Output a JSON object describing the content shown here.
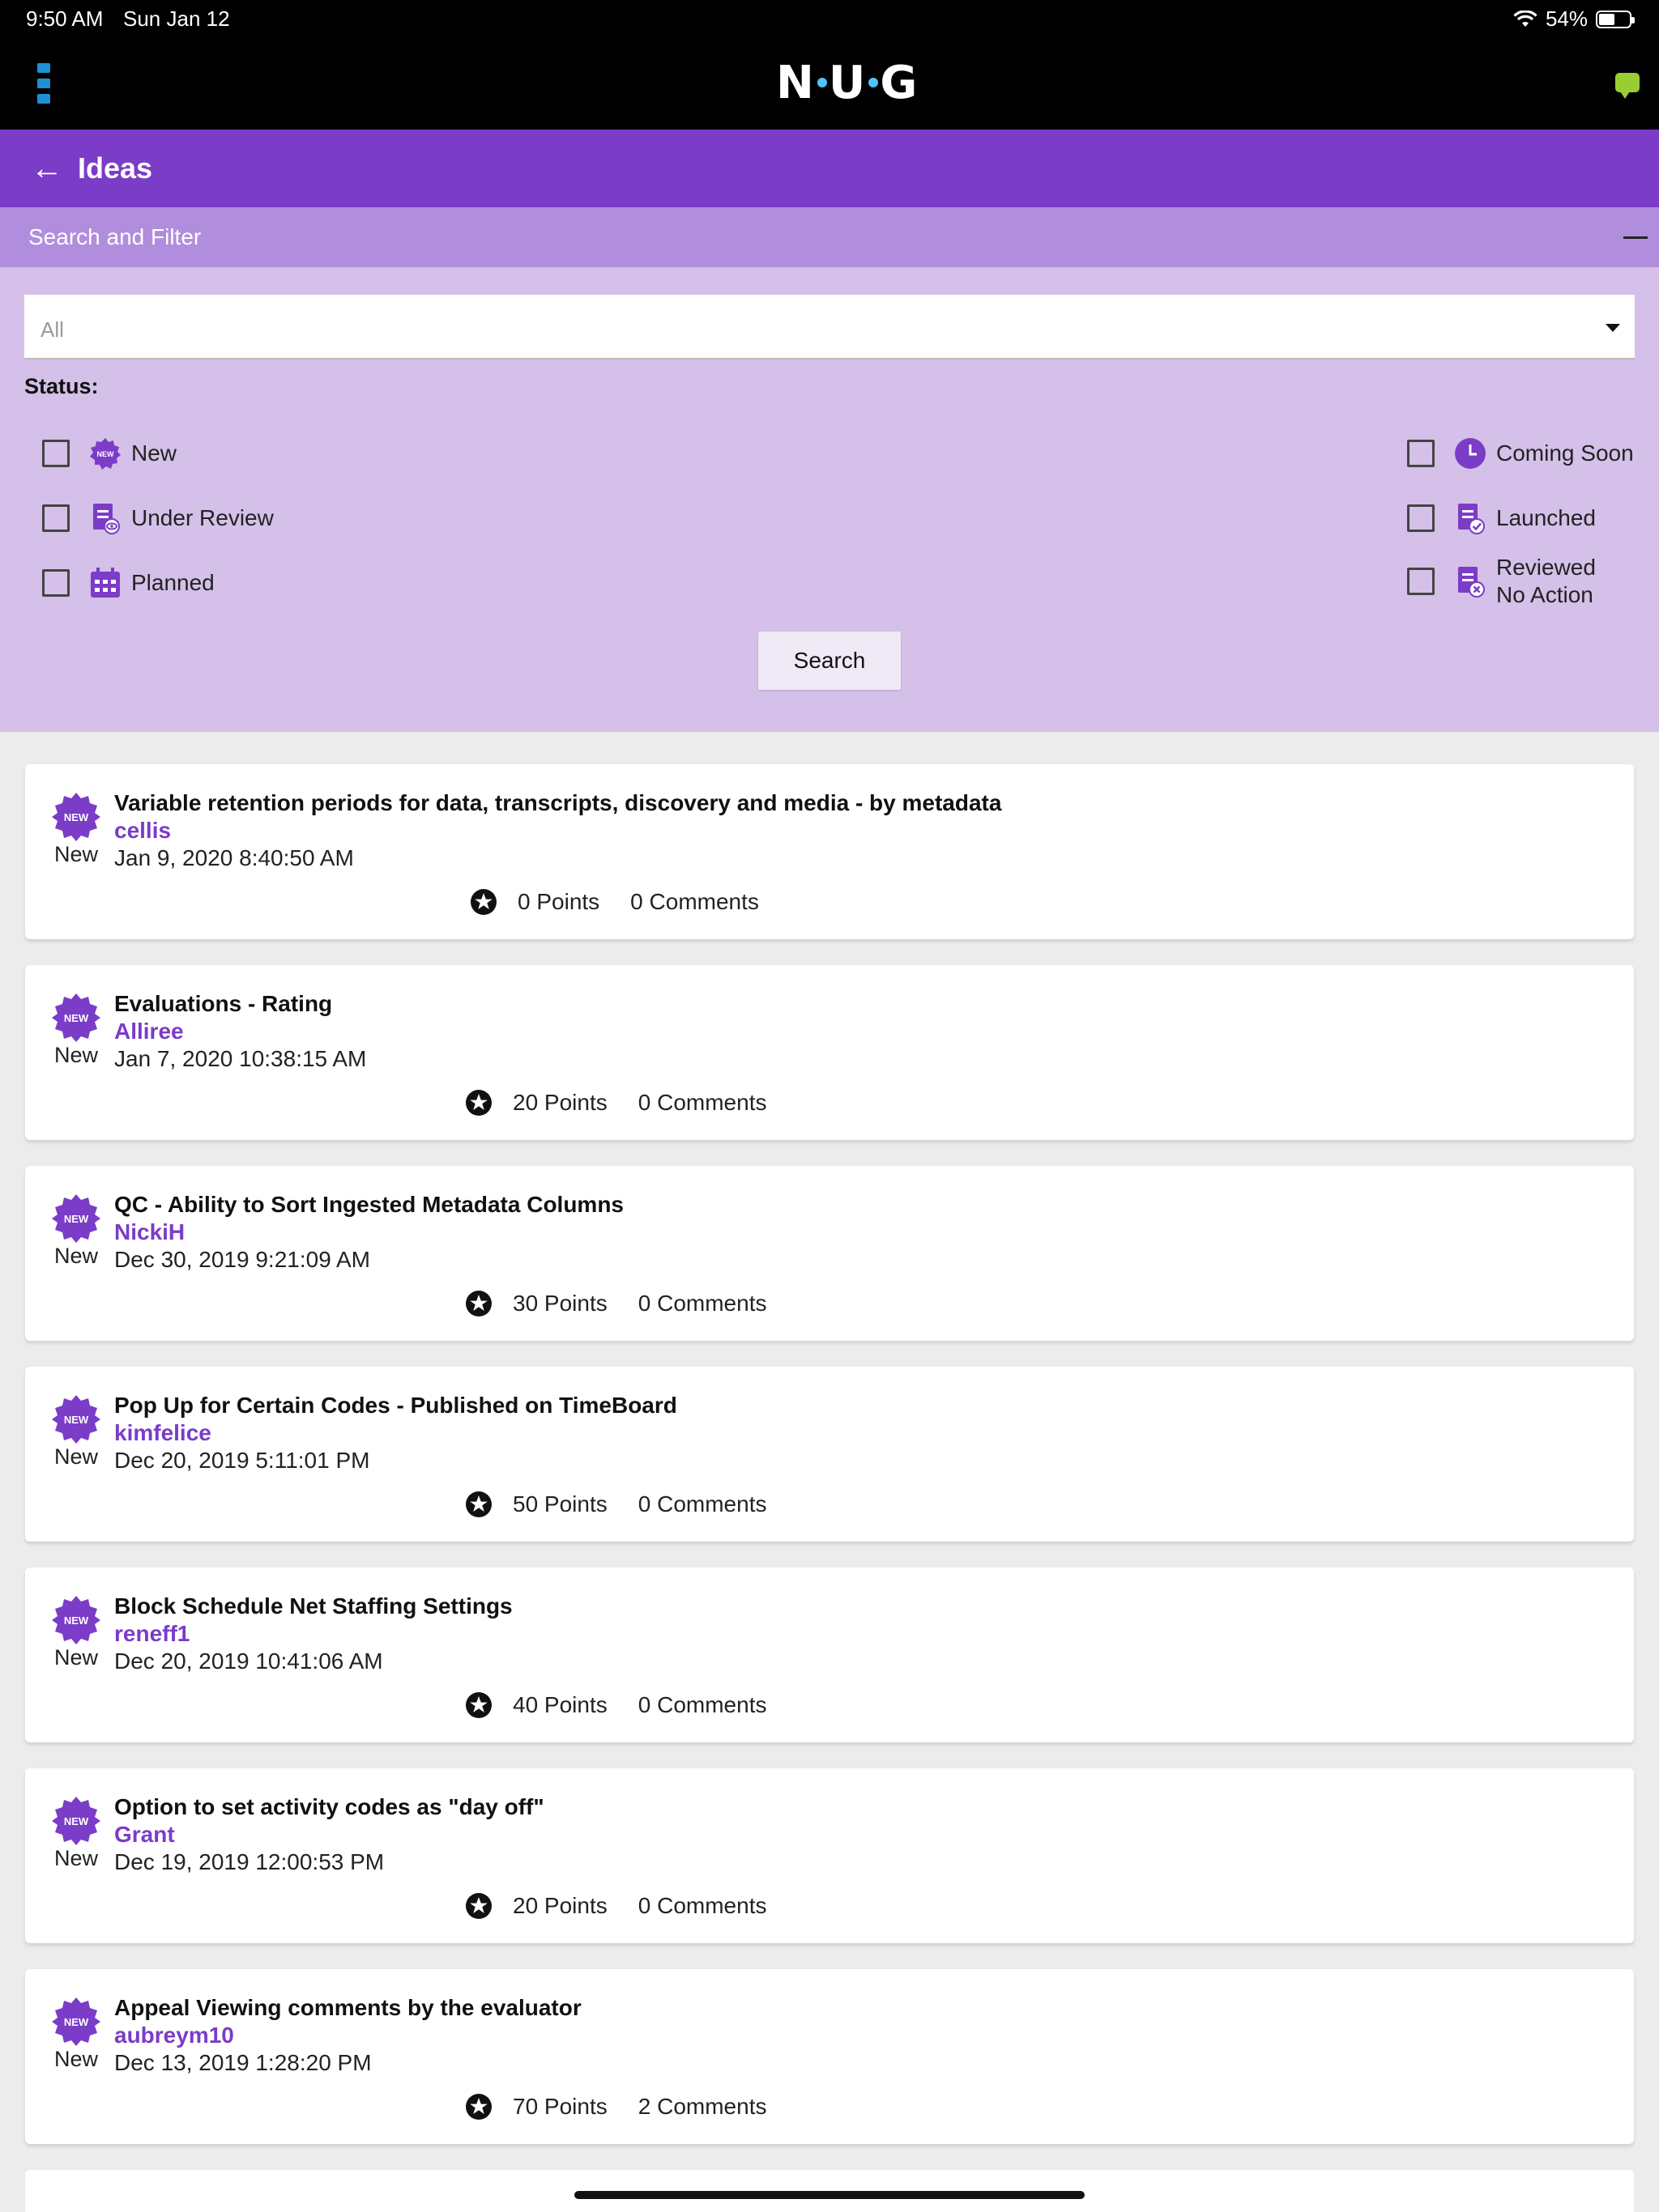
{
  "status_bar": {
    "time": "9:50 AM",
    "date": "Sun Jan 12",
    "battery": "54%",
    "battery_level": 0.54,
    "icons": [
      "wifi-icon",
      "battery-icon"
    ]
  },
  "header": {
    "logo_left": "N",
    "logo_mid": "U",
    "logo_right": "G",
    "menu_icon": "vertical-dots-menu-icon",
    "chat_icon": "chat-bubble-icon",
    "accent_color": "#7b3cc8",
    "brand_blue": "#1e90d6",
    "chat_color": "#9acd32"
  },
  "titlebar": {
    "back_icon": "back-arrow-icon",
    "title": "Ideas"
  },
  "filter": {
    "header_label": "Search and Filter",
    "collapse_icon": "minus-icon",
    "select_value": "All",
    "status_label": "Status:",
    "statuses_left": [
      {
        "label": "New",
        "icon": "new-badge-icon"
      },
      {
        "label": "Under Review",
        "icon": "document-eye-icon"
      },
      {
        "label": "Planned",
        "icon": "calendar-icon"
      }
    ],
    "statuses_right": [
      {
        "label": "Coming Soon",
        "icon": "clock-icon"
      },
      {
        "label": "Launched",
        "icon": "document-check-icon"
      },
      {
        "label_line1": "Reviewed",
        "label_line2": "No Action",
        "icon": "document-x-icon"
      }
    ],
    "search_button": "Search"
  },
  "ideas": [
    {
      "badge_text": "NEW",
      "status": "New",
      "title": "Variable retention periods for data, transcripts, discovery and media - by metadata",
      "author": "cellis",
      "date": "Jan 9, 2020 8:40:50 AM",
      "points": "0 Points",
      "comments": "0 Comments"
    },
    {
      "badge_text": "NEW",
      "status": "New",
      "title": "Evaluations - Rating",
      "author": "Alliree",
      "date": "Jan 7, 2020 10:38:15 AM",
      "points": "20 Points",
      "comments": "0 Comments"
    },
    {
      "badge_text": "NEW",
      "status": "New",
      "title": "QC - Ability to Sort Ingested Metadata Columns",
      "author": "NickiH",
      "date": "Dec 30, 2019 9:21:09 AM",
      "points": "30 Points",
      "comments": "0 Comments"
    },
    {
      "badge_text": "NEW",
      "status": "New",
      "title": "Pop Up for Certain Codes - Published on TimeBoard",
      "author": "kimfelice",
      "date": "Dec 20, 2019 5:11:01 PM",
      "points": "50 Points",
      "comments": "0 Comments"
    },
    {
      "badge_text": "NEW",
      "status": "New",
      "title": "Block Schedule Net Staffing Settings",
      "author": "reneff1",
      "date": "Dec 20, 2019 10:41:06 AM",
      "points": "40 Points",
      "comments": "0 Comments"
    },
    {
      "badge_text": "NEW",
      "status": "New",
      "title": "Option to set activity codes as \"day off\"",
      "author": "Grant",
      "date": "Dec 19, 2019 12:00:53 PM",
      "points": "20 Points",
      "comments": "0 Comments"
    },
    {
      "badge_text": "NEW",
      "status": "New",
      "title": "Appeal Viewing comments by the evaluator",
      "author": "aubreym10",
      "date": "Dec 13, 2019 1:28:20 PM",
      "points": "70 Points",
      "comments": "2 Comments"
    }
  ]
}
